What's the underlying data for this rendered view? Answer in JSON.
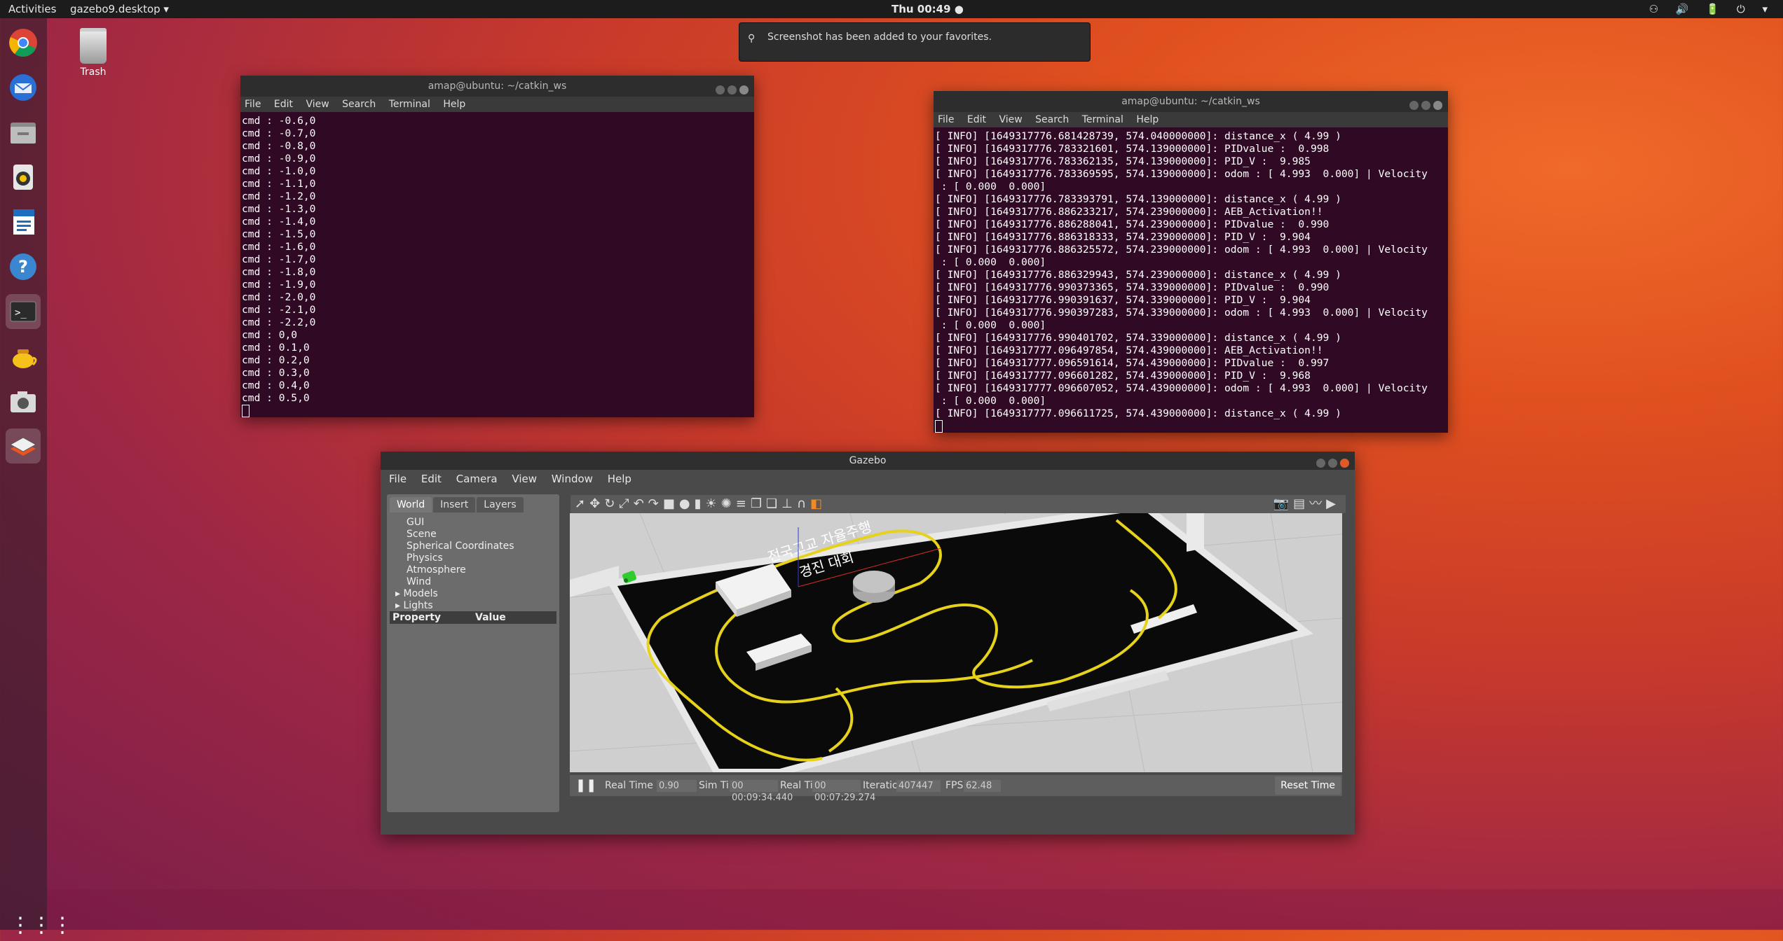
{
  "topbar": {
    "activities": "Activities",
    "app_menu": "gazebo9.desktop ▾",
    "clock": "Thu 00:49 ●",
    "system_icons": "⚇ 🔊 🔋 ⏻ ▾"
  },
  "desktop": {
    "trash_label": "Trash"
  },
  "notification": {
    "text": "Screenshot has been added to your favorites."
  },
  "dock": [
    "chrome-icon",
    "thunderbird-icon",
    "files-icon",
    "rhythmbox-icon",
    "writer-icon",
    "help-icon",
    "terminal-icon",
    "tea-icon",
    "screenshot-icon",
    "ubuntu-software-icon"
  ],
  "term1": {
    "title": "amap@ubuntu: ~/catkin_ws",
    "menu": [
      "File",
      "Edit",
      "View",
      "Search",
      "Terminal",
      "Help"
    ],
    "lines": [
      "cmd : -0.6,0",
      "cmd : -0.7,0",
      "cmd : -0.8,0",
      "cmd : -0.9,0",
      "cmd : -1.0,0",
      "cmd : -1.1,0",
      "cmd : -1.2,0",
      "cmd : -1.3,0",
      "cmd : -1.4,0",
      "cmd : -1.5,0",
      "cmd : -1.6,0",
      "cmd : -1.7,0",
      "cmd : -1.8,0",
      "cmd : -1.9,0",
      "cmd : -2.0,0",
      "cmd : -2.1,0",
      "cmd : -2.2,0",
      "cmd : 0,0",
      "cmd : 0.1,0",
      "cmd : 0.2,0",
      "cmd : 0.3,0",
      "cmd : 0.4,0",
      "cmd : 0.5,0"
    ]
  },
  "term2": {
    "title": "amap@ubuntu: ~/catkin_ws",
    "menu": [
      "File",
      "Edit",
      "View",
      "Search",
      "Terminal",
      "Help"
    ],
    "lines": [
      "[ INFO] [1649317776.681428739, 574.040000000]: distance_x ( 4.99 )",
      "[ INFO] [1649317776.783321601, 574.139000000]: PIDvalue :  0.998",
      "[ INFO] [1649317776.783362135, 574.139000000]: PID_V :  9.985",
      "[ INFO] [1649317776.783369595, 574.139000000]: odom : [ 4.993  0.000] | Velocity",
      " : [ 0.000  0.000]",
      "[ INFO] [1649317776.783393791, 574.139000000]: distance_x ( 4.99 )",
      "[ INFO] [1649317776.886233217, 574.239000000]: AEB_Activation!!",
      "[ INFO] [1649317776.886288041, 574.239000000]: PIDvalue :  0.990",
      "[ INFO] [1649317776.886318333, 574.239000000]: PID_V :  9.904",
      "[ INFO] [1649317776.886325572, 574.239000000]: odom : [ 4.993  0.000] | Velocity",
      " : [ 0.000  0.000]",
      "[ INFO] [1649317776.886329943, 574.239000000]: distance_x ( 4.99 )",
      "[ INFO] [1649317776.990373365, 574.339000000]: PIDvalue :  0.990",
      "[ INFO] [1649317776.990391637, 574.339000000]: PID_V :  9.904",
      "[ INFO] [1649317776.990397283, 574.339000000]: odom : [ 4.993  0.000] | Velocity",
      " : [ 0.000  0.000]",
      "[ INFO] [1649317776.990401702, 574.339000000]: distance_x ( 4.99 )",
      "[ INFO] [1649317777.096497854, 574.439000000]: AEB_Activation!!",
      "[ INFO] [1649317777.096591614, 574.439000000]: PIDvalue :  0.997",
      "[ INFO] [1649317777.096601282, 574.439000000]: PID_V :  9.968",
      "[ INFO] [1649317777.096607052, 574.439000000]: odom : [ 4.993  0.000] | Velocity",
      " : [ 0.000  0.000]",
      "[ INFO] [1649317777.096611725, 574.439000000]: distance_x ( 4.99 )"
    ]
  },
  "gazebo": {
    "title": "Gazebo",
    "menu": [
      "File",
      "Edit",
      "Camera",
      "View",
      "Window",
      "Help"
    ],
    "tabs": [
      "World",
      "Insert",
      "Layers"
    ],
    "tree": [
      "GUI",
      "Scene",
      "Spherical Coordinates",
      "Physics",
      "Atmosphere",
      "Wind",
      "Models",
      "Lights"
    ],
    "prop_header": {
      "property": "Property",
      "value": "Value"
    },
    "scene_text_line1": "전국고교 자율주행",
    "scene_text_line2": "경진 대회",
    "status": {
      "rtf_label": "Real Time Factor:",
      "rtf_value": "0.90",
      "sim_label": "Sim Time:",
      "sim_value": "00 00:09:34.440",
      "real_label": "Real Time:",
      "real_value": "00 00:07:29.274",
      "iter_label": "Iterations:",
      "iter_value": "407447",
      "fps_label": "FPS:",
      "fps_value": "62.48",
      "reset_label": "Reset Time"
    }
  }
}
